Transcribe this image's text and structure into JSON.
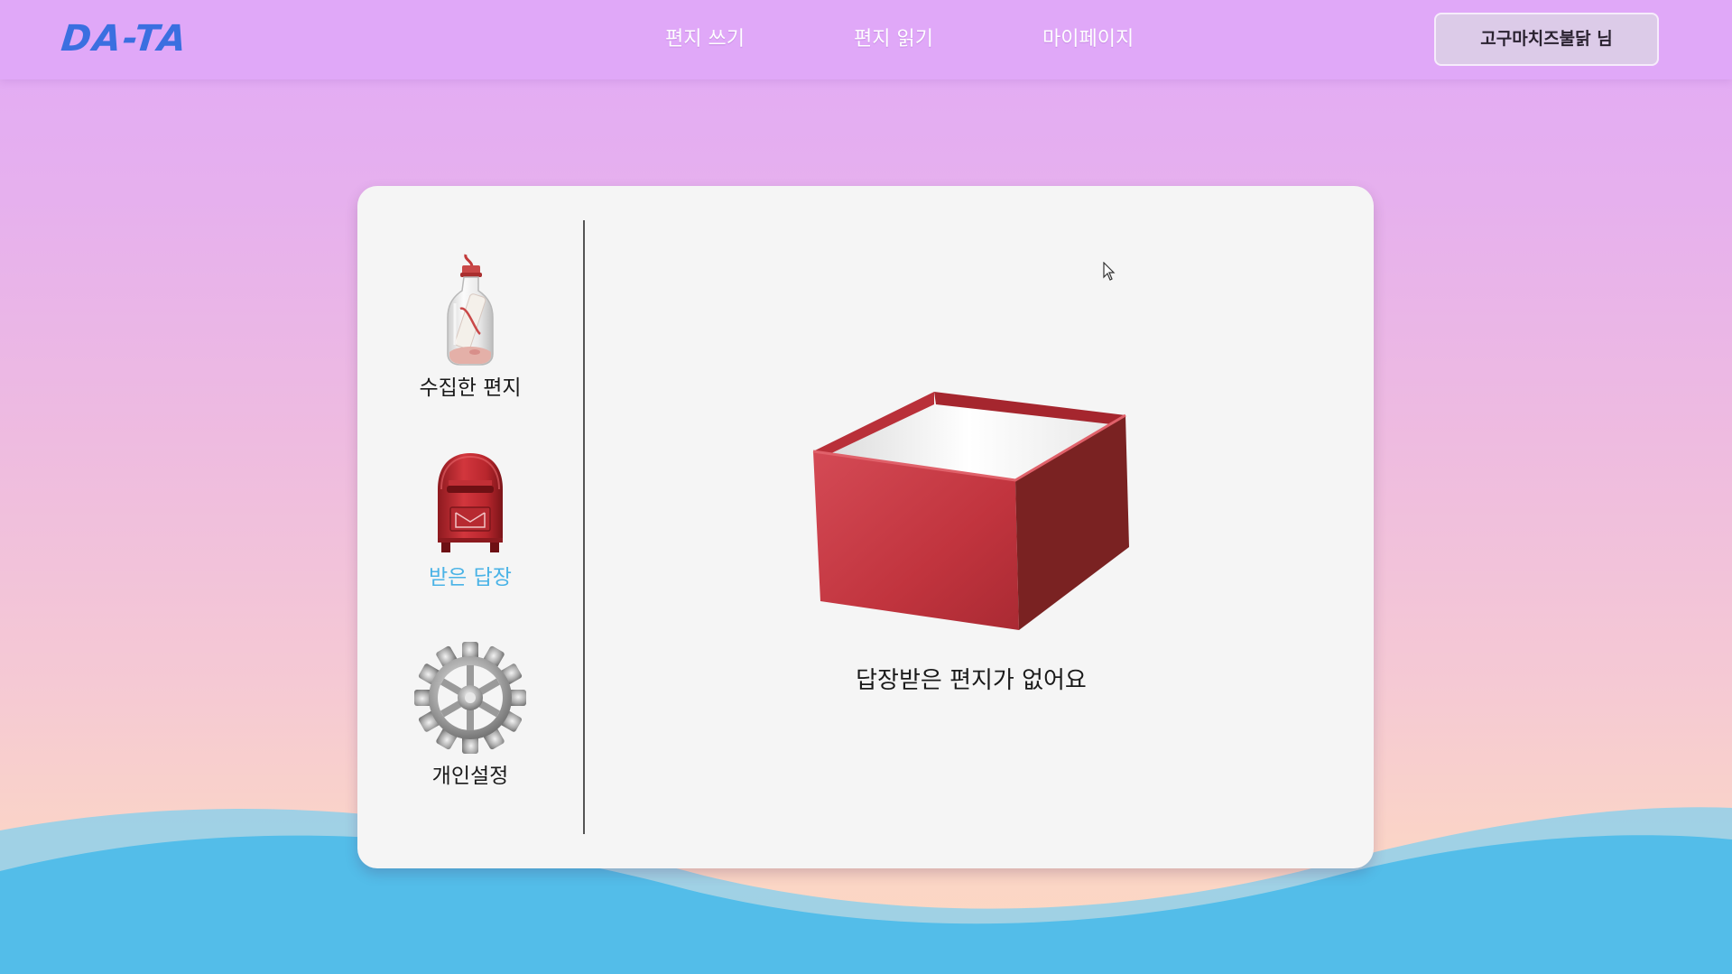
{
  "header": {
    "logo": "DA-TA",
    "nav": {
      "write": "편지 쓰기",
      "read": "편지 읽기",
      "mypage": "마이페이지"
    },
    "user_button": "고구마치즈불닭 님"
  },
  "sidebar": {
    "items": [
      {
        "label": "수집한 편지",
        "icon": "message-bottle-icon",
        "active": false
      },
      {
        "label": "받은 답장",
        "icon": "mailbox-icon",
        "active": true
      },
      {
        "label": "개인설정",
        "icon": "gear-icon",
        "active": false
      }
    ]
  },
  "main": {
    "empty_icon": "empty-box-icon",
    "empty_message": "답장받은 편지가 없어요"
  },
  "colors": {
    "header_bg": "#e0a8f8",
    "logo": "#3b6fe0",
    "active_menu": "#4ab3e6",
    "box_red": "#c8323f",
    "wave_blue": "#53bde9"
  }
}
